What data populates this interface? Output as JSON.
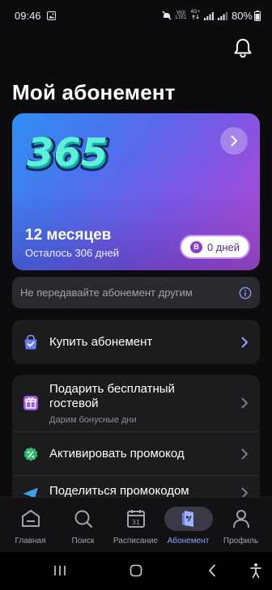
{
  "status_bar": {
    "time": "09:46",
    "volte_line1": "Vo))",
    "volte_line2": "LTE1",
    "net_gen": "4G+",
    "battery": "80%"
  },
  "header": {
    "title": "Мой абонемент",
    "icons": [
      "bell-icon"
    ]
  },
  "subscription_card": {
    "logo": "365",
    "term": "12 месяцев",
    "remaining": "Осталось 306 дней",
    "badge_letter": "B",
    "days_pill": "0 дней",
    "colors": {
      "gradient_start": "#2f8ff2",
      "gradient_end": "#b24fd2",
      "pill_text": "#5a2a97"
    }
  },
  "notice": {
    "text": "Не передавайте абонемент другим",
    "icon": "info-icon"
  },
  "buy": {
    "label": "Купить абонемент",
    "icon": "shopping-bag-icon"
  },
  "actions": [
    {
      "label": "Подарить бесплатный гостевой",
      "sub": "Дарим бонусные дни",
      "icon": "gift-icon"
    },
    {
      "label": "Активировать промокод",
      "icon": "promo-badge-icon"
    },
    {
      "label": "Поделиться промокодом",
      "icon": "send-icon"
    }
  ],
  "tabs": [
    {
      "label": "Главная",
      "icon": "home-icon"
    },
    {
      "label": "Поиск",
      "icon": "search-icon"
    },
    {
      "label": "Расписание",
      "icon": "calendar-icon",
      "calendar_day": "31"
    },
    {
      "label": "Абонемент",
      "icon": "membership-card-icon",
      "active": true
    },
    {
      "label": "Профиль",
      "icon": "profile-icon"
    }
  ],
  "accent_color": "#8fa4ff"
}
